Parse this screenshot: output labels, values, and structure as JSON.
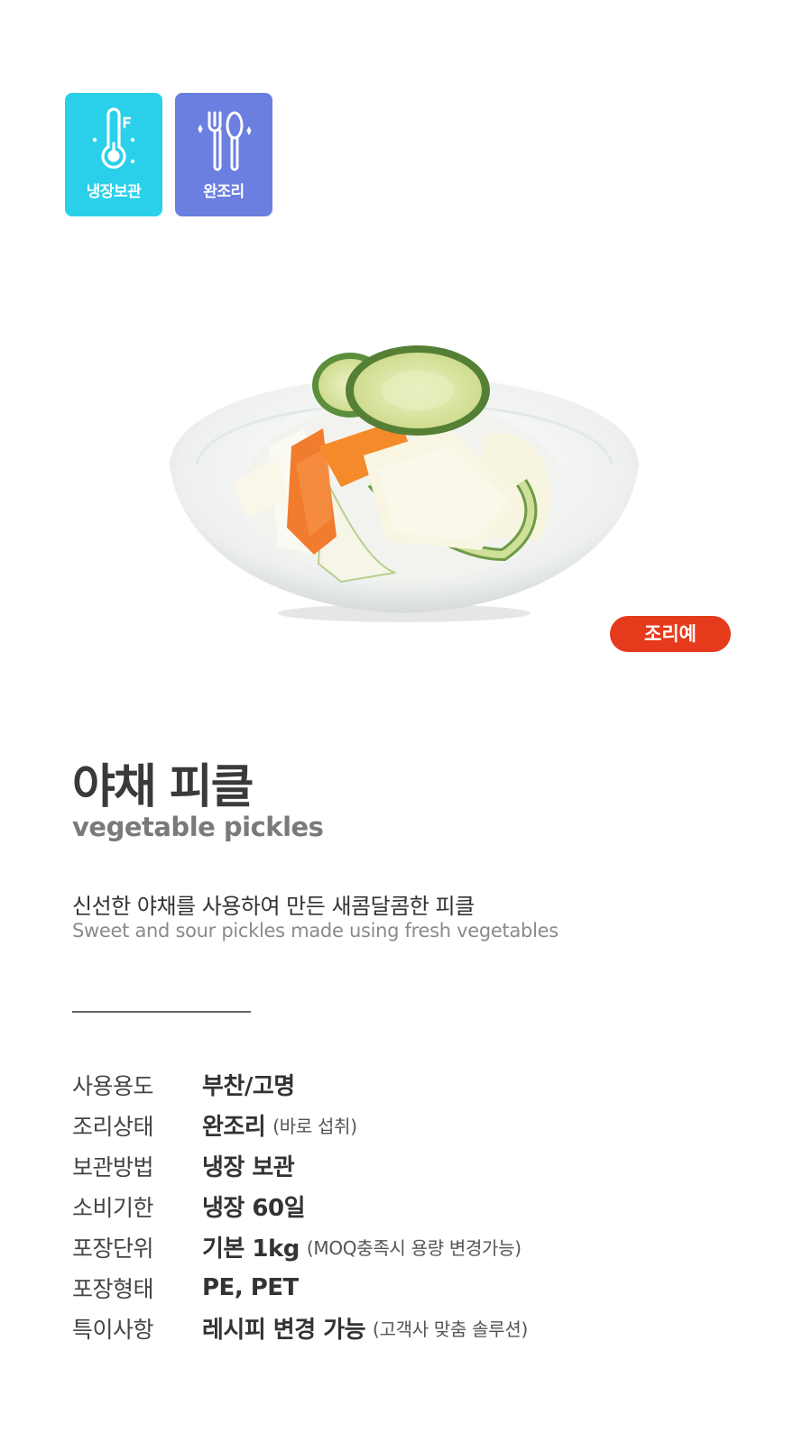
{
  "badges": [
    {
      "label": "냉장보관",
      "icon": "thermometer-icon",
      "color": "#2ad0ea"
    },
    {
      "label": "완조리",
      "icon": "fork-spoon-icon",
      "color": "#6b7fe0"
    }
  ],
  "image_badge": "조리예",
  "product": {
    "title_ko": "야채 피클",
    "title_en": "vegetable pickles",
    "desc_ko": "신선한 야채를 사용하여 만든 새콤달콤한 피클",
    "desc_en": "Sweet and sour pickles made using fresh vegetables"
  },
  "specs": [
    {
      "key": "사용용도",
      "value": "부찬/고명",
      "note": ""
    },
    {
      "key": "조리상태",
      "value": "완조리",
      "note": "(바로 섭취)"
    },
    {
      "key": "보관방법",
      "value": "냉장 보관",
      "note": ""
    },
    {
      "key": "소비기한",
      "value": "냉장 60일",
      "note": ""
    },
    {
      "key": "포장단위",
      "value": "기본 1kg",
      "note": "(MOQ충족시 용량 변경가능)"
    },
    {
      "key": "포장형태",
      "value": "PE, PET",
      "note": ""
    },
    {
      "key": "특이사항",
      "value": "레시피 변경 가능",
      "note": "(고객사 맞춤 솔루션)"
    }
  ],
  "colors": {
    "accent_red": "#e53a1c",
    "cyan": "#2ad0ea",
    "indigo": "#6b7fe0"
  }
}
